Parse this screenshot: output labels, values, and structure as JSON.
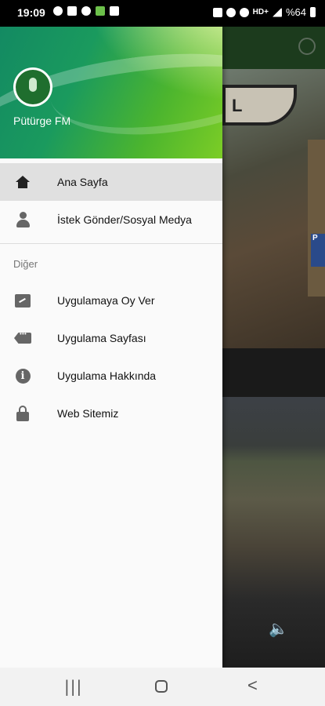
{
  "status_bar": {
    "time": "19:09",
    "network": "HD+",
    "battery": "%64"
  },
  "background_app": {
    "sign_text": "L DİNİZ",
    "blue_sign_text": "P",
    "icons": [
      "whatsapp-icon",
      "volume-icon"
    ]
  },
  "drawer": {
    "header": {
      "app_name": "Pütürge FM"
    },
    "primary_items": [
      {
        "label": "Ana Sayfa",
        "icon": "home-icon",
        "active": true
      },
      {
        "label": "İstek Gönder/Sosyal Medya",
        "icon": "person-icon",
        "active": false
      }
    ],
    "section_title": "Diğer",
    "secondary_items": [
      {
        "label": "Uygulamaya Oy Ver",
        "icon": "rate-review-icon"
      },
      {
        "label": "Uygulama Sayfası",
        "icon": "tag-icon"
      },
      {
        "label": "Uygulama Hakkında",
        "icon": "info-icon"
      },
      {
        "label": "Web Sitemiz",
        "icon": "lock-icon"
      }
    ]
  },
  "nav_bar": {
    "recents": "|||",
    "back": "<"
  },
  "colors": {
    "header_gradient_start": "#138a62",
    "header_gradient_end": "#7ccd26",
    "active_item_bg": "#e0e0e0",
    "drawer_bg": "#fafafa"
  }
}
